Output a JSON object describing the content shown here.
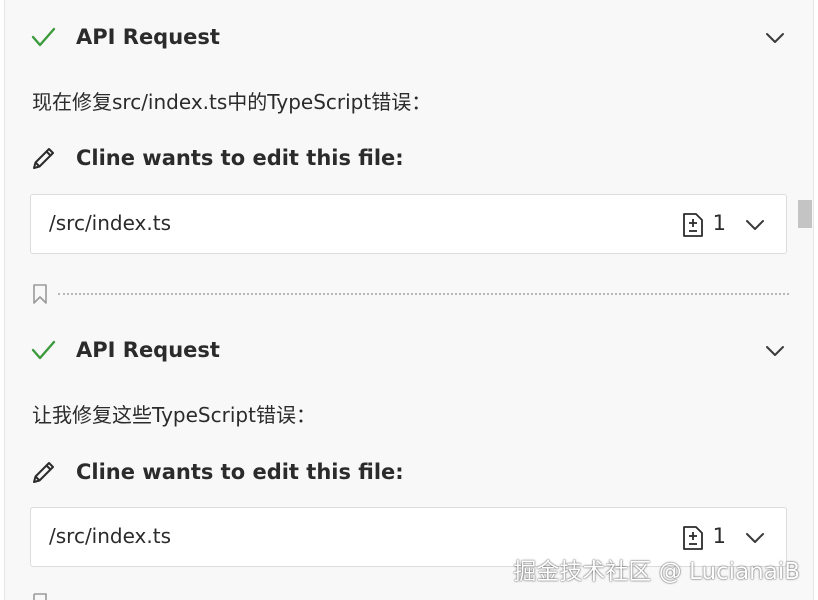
{
  "blocks": [
    {
      "header": {
        "title": "API Request"
      },
      "message": "现在修复src/index.ts中的TypeScript错误：",
      "edit": {
        "title": "Cline wants to edit this file:",
        "file_path": "/src/index.ts",
        "diff_count": "1"
      }
    },
    {
      "header": {
        "title": "API Request"
      },
      "message": "让我修复这些TypeScript错误：",
      "edit": {
        "title": "Cline wants to edit this file:",
        "file_path": "/src/index.ts",
        "diff_count": "1"
      }
    }
  ],
  "watermark": "掘金技术社区 @ LucianaiB",
  "colors": {
    "check": "#3c9a3c",
    "panel_bg": "#f8f8f8",
    "card_bg": "#ffffff",
    "text": "#2b2b2b"
  },
  "icons": [
    "check-icon",
    "chevron-down-icon",
    "pencil-icon",
    "diff-file-icon",
    "bookmark-icon"
  ]
}
